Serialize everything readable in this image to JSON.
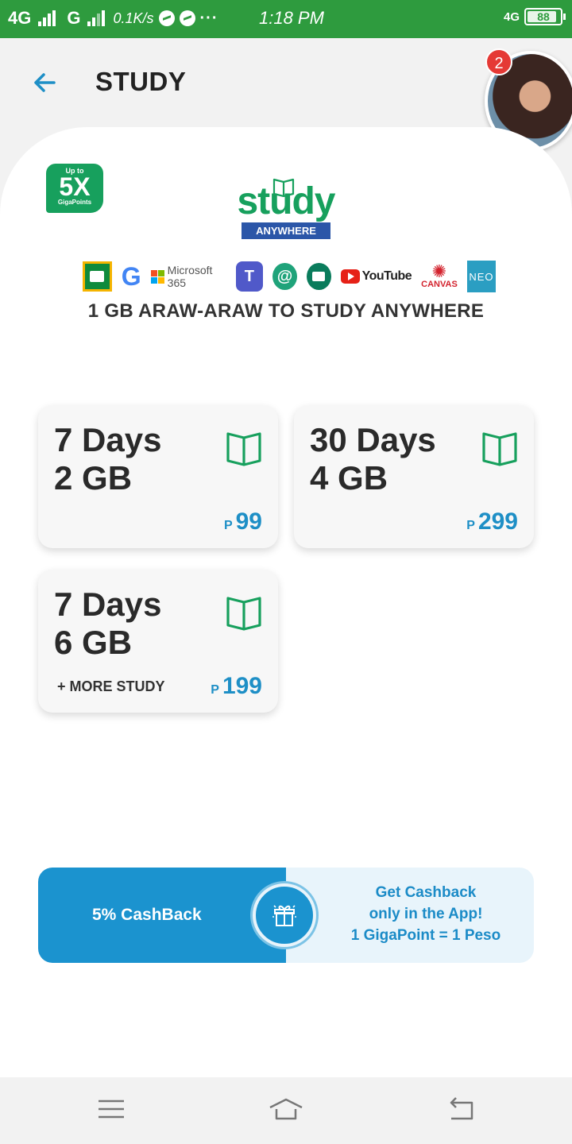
{
  "status_bar": {
    "network1": "4G",
    "network2": "G",
    "speed": "0.1K/s",
    "dots": "···",
    "time": "1:18 PM",
    "net_right": "4G",
    "battery": "88"
  },
  "header": {
    "title": "STUDY",
    "notification_count": "2"
  },
  "promo": {
    "badge_up_to": "Up to",
    "badge_multiplier": "5X",
    "badge_label": "GigaPoints",
    "logo_word": "study",
    "logo_sub": "ANYWHERE",
    "apps": {
      "google": "G",
      "microsoft": "Microsoft 365",
      "teams": "T",
      "at": "@",
      "youtube": "YouTube",
      "canvas": "CANVAS",
      "neo": "NEO"
    },
    "tagline": "1 GB ARAW-ARAW TO STUDY ANYWHERE"
  },
  "plans": [
    {
      "days": "7 Days",
      "data": "2 GB",
      "currency": "P",
      "price": "99",
      "extra": ""
    },
    {
      "days": "30 Days",
      "data": "4 GB",
      "currency": "P",
      "price": "299",
      "extra": ""
    },
    {
      "days": "7 Days",
      "data": "6 GB",
      "currency": "P",
      "price": "199",
      "extra": "+ MORE STUDY"
    }
  ],
  "cashback": {
    "left": "5% CashBack",
    "line1": "Get Cashback",
    "line2": "only in the App!",
    "line3": "1 GigaPoint = 1 Peso"
  },
  "colors": {
    "status_green": "#2e9b3e",
    "accent_blue": "#1e8fc6",
    "brand_green": "#17a05d"
  }
}
